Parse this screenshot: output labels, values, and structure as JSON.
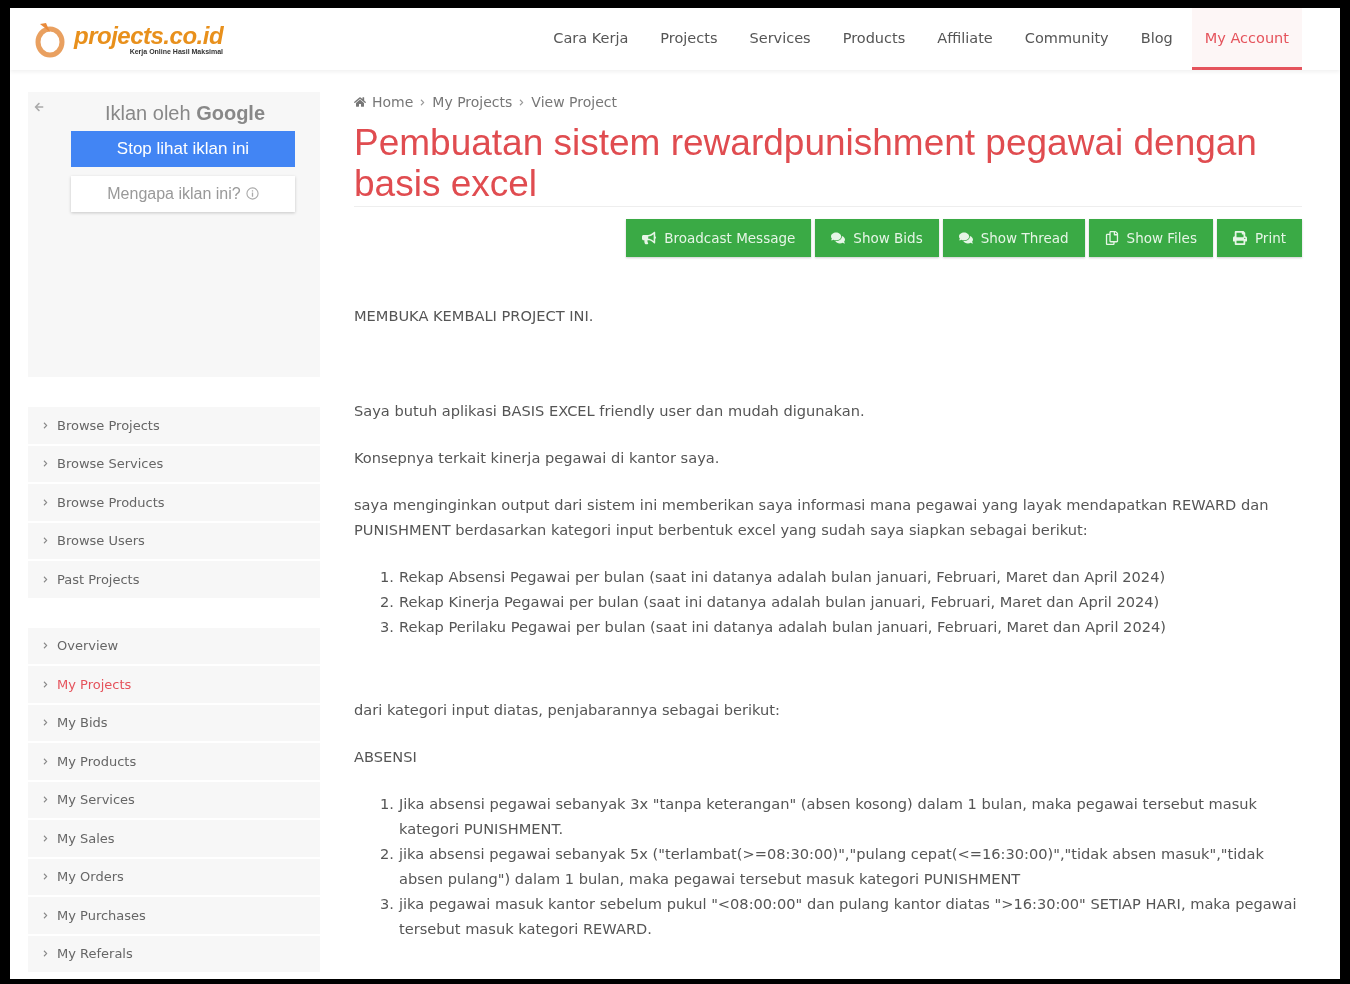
{
  "logo": {
    "name": "projects.co.id",
    "tagline": "Kerja Online Hasil Maksimal"
  },
  "nav": [
    {
      "label": "Cara Kerja",
      "selected": false
    },
    {
      "label": "Projects",
      "selected": false
    },
    {
      "label": "Services",
      "selected": false
    },
    {
      "label": "Products",
      "selected": false
    },
    {
      "label": "Affiliate",
      "selected": false
    },
    {
      "label": "Community",
      "selected": false
    },
    {
      "label": "Blog",
      "selected": false
    },
    {
      "label": "My Account",
      "selected": true
    }
  ],
  "ad": {
    "title": "Iklan oleh **Google**",
    "stop_button": "Stop lihat iklan ini",
    "why_button": "Mengapa iklan ini?"
  },
  "sidebar_groups": [
    [
      {
        "label": "Browse Projects",
        "selected": false
      },
      {
        "label": "Browse Services",
        "selected": false
      },
      {
        "label": "Browse Products",
        "selected": false
      },
      {
        "label": "Browse Users",
        "selected": false
      },
      {
        "label": "Past Projects",
        "selected": false
      }
    ],
    [
      {
        "label": "Overview",
        "selected": false
      },
      {
        "label": "My Projects",
        "selected": true
      },
      {
        "label": "My Bids",
        "selected": false
      },
      {
        "label": "My Products",
        "selected": false
      },
      {
        "label": "My Services",
        "selected": false
      },
      {
        "label": "My Sales",
        "selected": false
      },
      {
        "label": "My Orders",
        "selected": false
      },
      {
        "label": "My Purchases",
        "selected": false
      },
      {
        "label": "My Referals",
        "selected": false
      }
    ]
  ],
  "breadcrumb": [
    "Home",
    "My Projects",
    "View Project"
  ],
  "title": "Pembuatan sistem rewardpunishment pegawai dengan basis excel",
  "actions": [
    {
      "kind": "broadcast",
      "label": "Broadcast Message"
    },
    {
      "kind": "bids",
      "label": "Show Bids"
    },
    {
      "kind": "thread",
      "label": "Show Thread"
    },
    {
      "kind": "files",
      "label": "Show Files"
    },
    {
      "kind": "print",
      "label": "Print"
    }
  ],
  "content": [
    {
      "kind": "paragraph",
      "text": "MEMBUKA KEMBALI PROJECT INI."
    },
    {
      "kind": "paragraph",
      "text": "Saya butuh aplikasi BASIS EXCEL friendly user dan mudah digunakan."
    },
    {
      "kind": "paragraph",
      "text": "Konsepnya terkait kinerja pegawai di kantor saya."
    },
    {
      "kind": "paragraph",
      "text": "saya menginginkan output dari sistem ini memberikan saya informasi mana pegawai yang layak mendapatkan REWARD dan PUNISHMENT berdasarkan kategori input berbentuk excel yang sudah saya siapkan sebagai berikut:"
    },
    {
      "kind": "list",
      "items": [
        {
          "number": "1.",
          "text": "Rekap Absensi Pegawai per bulan (saat ini datanya adalah bulan januari, Februari, Maret dan April 2024)"
        },
        {
          "number": "2.",
          "text": "Rekap Kinerja Pegawai per bulan (saat ini datanya adalah bulan januari, Februari, Maret dan April 2024)"
        },
        {
          "number": "3.",
          "text": "Rekap Perilaku Pegawai per bulan (saat ini datanya adalah bulan januari, Februari, Maret dan April 2024)"
        }
      ]
    },
    {
      "kind": "paragraph",
      "text": "dari kategori input diatas, penjabarannya sebagai berikut:"
    },
    {
      "kind": "paragraph",
      "text": "ABSENSI"
    },
    {
      "kind": "list",
      "items": [
        {
          "number": "1.",
          "text": "Jika absensi pegawai sebanyak 3x \"tanpa keterangan\" (absen kosong) dalam 1 bulan, maka pegawai tersebut masuk kategori PUNISHMENT."
        },
        {
          "number": "2.",
          "text": "jika absensi pegawai sebanyak 5x (\"terlambat(>=08:30:00)\",\"pulang cepat(<=16:30:00)\",\"tidak absen masuk\",\"tidak absen pulang\") dalam 1 bulan, maka pegawai tersebut masuk kategori PUNISHMENT"
        },
        {
          "number": "3.",
          "text": "jika pegawai masuk kantor sebelum pukul \"<08:00:00\" dan pulang kantor diatas \">16:30:00\" SETIAP HARI, maka pegawai tersebut masuk kategori REWARD."
        }
      ]
    }
  ]
}
